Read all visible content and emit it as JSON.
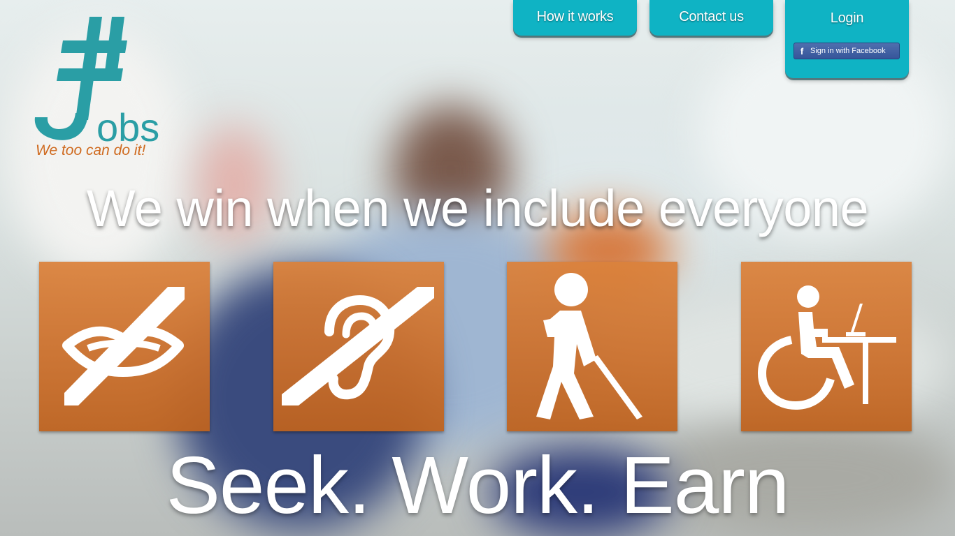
{
  "brand": {
    "logo_text": "#Jobs",
    "tagline": "We too can do it!",
    "logo_color": "#2a9ea5"
  },
  "nav": {
    "how_it_works": "How it works",
    "contact_us": "Contact us",
    "login": "Login",
    "facebook_signin": "Sign in with Facebook"
  },
  "hero": {
    "headline": "We win when we include everyone",
    "slogan": "Seek. Work. Earn"
  },
  "tiles": [
    {
      "icon": "speech-impaired-icon"
    },
    {
      "icon": "hearing-impaired-icon"
    },
    {
      "icon": "visually-impaired-icon"
    },
    {
      "icon": "wheelchair-workstation-icon"
    }
  ],
  "colors": {
    "accent_teal": "#0fb3c4",
    "tile_orange": "#d27838",
    "tagline_orange": "#cf6a1f",
    "facebook_blue": "#3b5998"
  }
}
